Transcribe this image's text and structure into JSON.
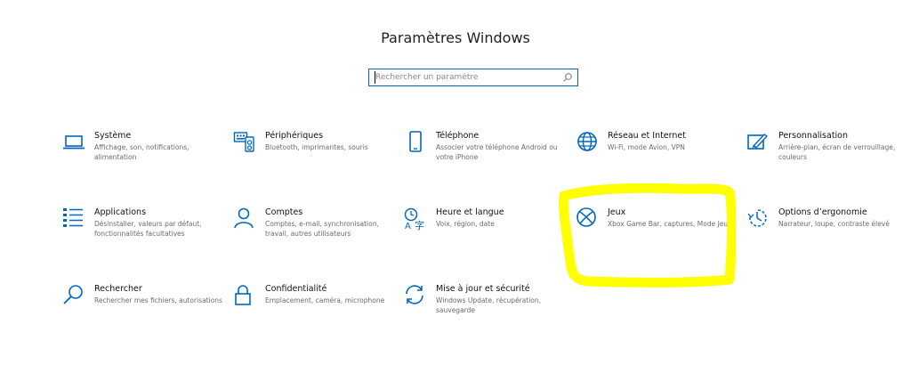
{
  "window": {
    "title": "Paramètres Windows"
  },
  "search": {
    "placeholder": "Rechercher un paramètre"
  },
  "accent_color": "#0067c0",
  "highlight_color": "#ffff00",
  "tiles": [
    {
      "icon": "laptop-icon",
      "title": "Système",
      "desc": "Affichage, son, notifications, alimentation"
    },
    {
      "icon": "keyboard-icon",
      "title": "Périphériques",
      "desc": "Bluetooth, imprimantes, souris"
    },
    {
      "icon": "phone-icon",
      "title": "Téléphone",
      "desc": "Associer votre téléphone Android ou votre iPhone"
    },
    {
      "icon": "globe-icon",
      "title": "Réseau et Internet",
      "desc": "Wi-Fi, mode Avion, VPN"
    },
    {
      "icon": "paintbrush-icon",
      "title": "Personnalisation",
      "desc": "Arrière-plan, écran de verrouillage, couleurs"
    },
    {
      "icon": "apps-list-icon",
      "title": "Applications",
      "desc": "Désinstaller, valeurs par défaut, fonctionnalités facultatives"
    },
    {
      "icon": "person-icon",
      "title": "Comptes",
      "desc": "Comptes, e-mail, synchronisation, travail, autres utilisateurs"
    },
    {
      "icon": "time-language-icon",
      "title": "Heure et langue",
      "desc": "Voix, région, date"
    },
    {
      "icon": "xbox-icon",
      "title": "Jeux",
      "desc": "Xbox Game Bar, captures, Mode Jeu"
    },
    {
      "icon": "ease-of-access-icon",
      "title": "Options d’ergonomie",
      "desc": "Narrateur, loupe, contraste élevé"
    },
    {
      "icon": "search-icon",
      "title": "Rechercher",
      "desc": "Rechercher mes fichiers, autorisations"
    },
    {
      "icon": "lock-icon",
      "title": "Confidentialité",
      "desc": "Emplacement, caméra, microphone"
    },
    {
      "icon": "update-icon",
      "title": "Mise à jour et sécurité",
      "desc": "Windows Update, récupération, sauvegarde"
    }
  ]
}
